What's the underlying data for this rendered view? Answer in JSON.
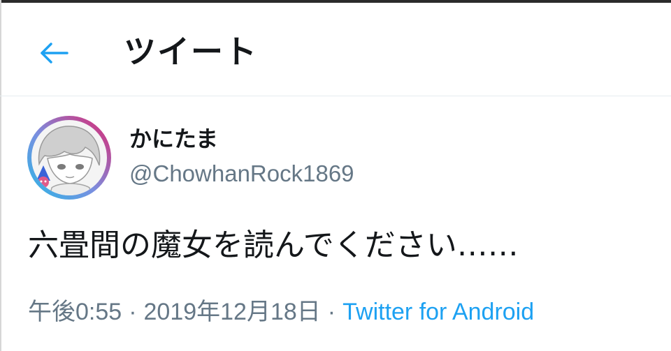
{
  "header": {
    "back_icon": "arrow-left-icon",
    "title": "ツイート"
  },
  "tweet": {
    "author": {
      "display_name": "かにたま",
      "handle": "@ChowhanRock1869"
    },
    "text": "六畳間の魔女を読んでください……",
    "time": "午後0:55",
    "separator": "·",
    "date": "2019年12月18日",
    "source": "Twitter for Android"
  },
  "colors": {
    "accent": "#1da1f2",
    "text": "#14171a",
    "secondary_text": "#657786",
    "avatar_ring_pink": "#e0246e",
    "avatar_ring_cyan": "#28b8e6"
  }
}
